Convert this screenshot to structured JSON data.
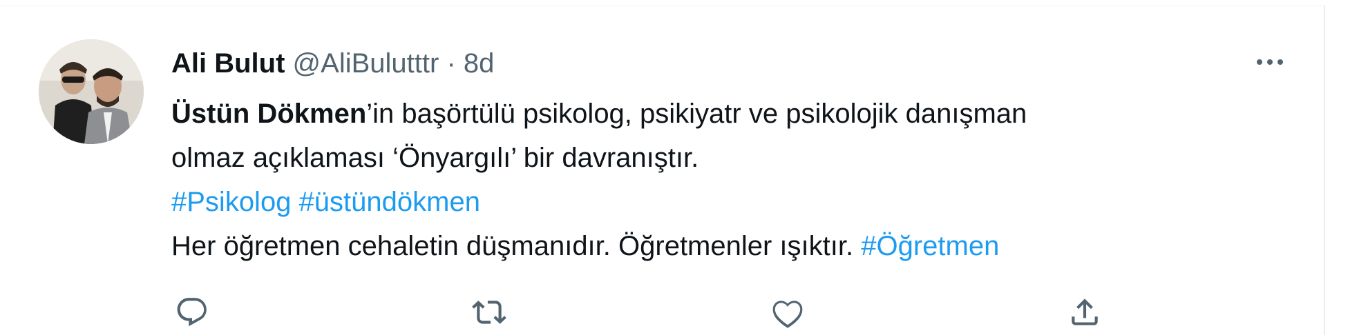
{
  "tweet": {
    "author_name": "Ali Bulut",
    "author_handle": "@AliBulutttr",
    "separator": " · ",
    "time": "8d",
    "line1_mention": "Üstün Dökmen",
    "line1_rest": "’in başörtülü psikolog, psikiyatr ve psikolojik danışman",
    "line2": "olmaz açıklaması ‘Önyargılı’ bir davranıştır.",
    "line3_hashtags": [
      "#Psikolog",
      "#üstündökmen"
    ],
    "line4_text": "Her öğretmen cehaletin düşmanıdır. Öğretmenler ışıktır.",
    "line4_hashtag": "#Öğretmen"
  },
  "actions": [
    {
      "name": "reply",
      "icon": "reply-icon"
    },
    {
      "name": "retweet",
      "icon": "retweet-icon"
    },
    {
      "name": "like",
      "icon": "heart-icon"
    },
    {
      "name": "share",
      "icon": "share-icon"
    }
  ],
  "colors": {
    "text": "#0f1419",
    "secondary": "#536471",
    "link": "#1d9bf0"
  }
}
